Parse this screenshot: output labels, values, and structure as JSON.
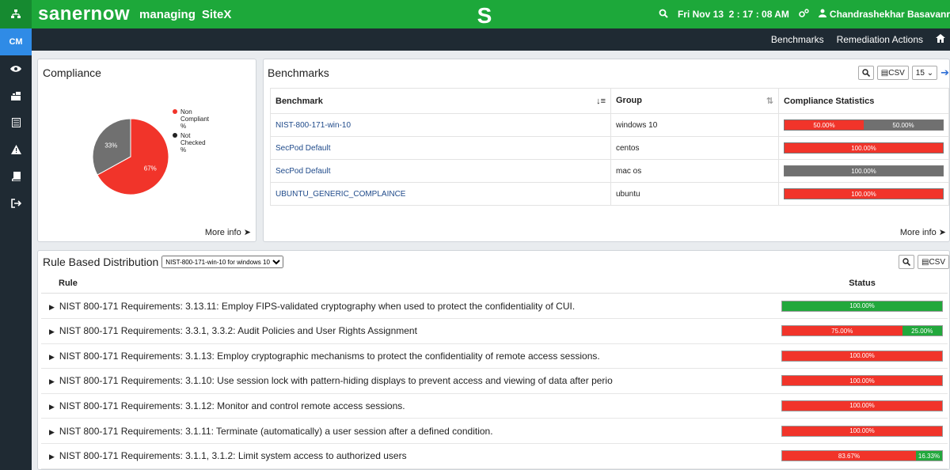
{
  "header": {
    "brand": "sanernow",
    "managing": "managing",
    "site": "SiteX",
    "logo": "S",
    "date": "Fri Nov 13",
    "time": "2 : 17 : 08 AM",
    "user": "Chandrashekhar Basavanr"
  },
  "subnav": {
    "benchmarks": "Benchmarks",
    "remediation": "Remediation Actions"
  },
  "sidebar": {
    "active": "CM"
  },
  "compliance": {
    "title": "Compliance",
    "more_info": "More info",
    "legend": [
      {
        "label": "Non Compliant %",
        "color": "#f1342a"
      },
      {
        "label": "Not Checked %",
        "color": "#222222"
      }
    ],
    "chart_data": {
      "type": "pie",
      "categories": [
        "Non Compliant %",
        "Not Checked %"
      ],
      "values": [
        67,
        33
      ]
    }
  },
  "benchmarks": {
    "title": "Benchmarks",
    "csv": "CSV",
    "page_size": "15",
    "more_info": "More info",
    "columns": [
      "Benchmark",
      "Group",
      "Compliance Statistics"
    ],
    "rows": [
      {
        "name": "NIST-800-171-win-10",
        "group": "windows 10",
        "segments": [
          {
            "pct": 50,
            "label": "50.00%",
            "color": "red"
          },
          {
            "pct": 50,
            "label": "50.00%",
            "color": "gray"
          }
        ]
      },
      {
        "name": "SecPod Default",
        "group": "centos",
        "segments": [
          {
            "pct": 100,
            "label": "100.00%",
            "color": "red"
          }
        ]
      },
      {
        "name": "SecPod Default",
        "group": "mac os",
        "segments": [
          {
            "pct": 100,
            "label": "100.00%",
            "color": "gray"
          }
        ]
      },
      {
        "name": "UBUNTU_GENERIC_COMPLAINCE",
        "group": "ubuntu",
        "segments": [
          {
            "pct": 100,
            "label": "100.00%",
            "color": "red"
          }
        ]
      }
    ]
  },
  "rules": {
    "title": "Rule Based Distribution",
    "selected": "NIST-800-171-win-10 for windows 10",
    "csv": "CSV",
    "col_rule": "Rule",
    "col_status": "Status",
    "items": [
      {
        "text": "NIST 800-171 Requirements: 3.13.11: Employ FIPS-validated cryptography when used to protect the confidentiality of CUI.",
        "segments": [
          {
            "pct": 100,
            "label": "100.00%",
            "color": "green"
          }
        ]
      },
      {
        "text": "NIST 800-171 Requirements: 3.3.1, 3.3.2: Audit Policies and User Rights Assignment",
        "segments": [
          {
            "pct": 75,
            "label": "75.00%",
            "color": "red"
          },
          {
            "pct": 25,
            "label": "25.00%",
            "color": "green"
          }
        ]
      },
      {
        "text": "NIST 800-171 Requirements: 3.1.13: Employ cryptographic mechanisms to protect the confidentiality of remote access sessions.",
        "segments": [
          {
            "pct": 100,
            "label": "100.00%",
            "color": "red"
          }
        ]
      },
      {
        "text": "NIST 800-171 Requirements: 3.1.10: Use session lock with pattern-hiding displays to prevent access and viewing of data after perio",
        "segments": [
          {
            "pct": 100,
            "label": "100.00%",
            "color": "red"
          }
        ]
      },
      {
        "text": "NIST 800-171 Requirements: 3.1.12: Monitor and control remote access sessions.",
        "segments": [
          {
            "pct": 100,
            "label": "100.00%",
            "color": "red"
          }
        ]
      },
      {
        "text": "NIST 800-171 Requirements: 3.1.11: Terminate (automatically) a user session after a defined condition.",
        "segments": [
          {
            "pct": 100,
            "label": "100.00%",
            "color": "red"
          }
        ]
      },
      {
        "text": "NIST 800-171 Requirements: 3.1.1, 3.1.2: Limit system access to authorized users",
        "segments": [
          {
            "pct": 83.67,
            "label": "83.67%",
            "color": "red"
          },
          {
            "pct": 16.33,
            "label": "16.33%",
            "color": "green"
          }
        ]
      }
    ]
  }
}
